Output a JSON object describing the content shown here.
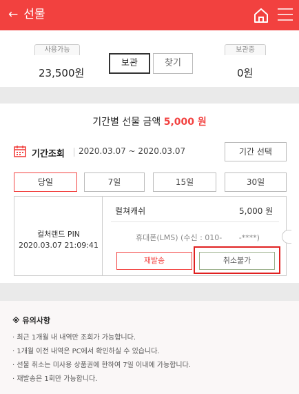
{
  "header": {
    "back_label": "선물",
    "colors": {
      "brand": "#f2413f"
    }
  },
  "storage": {
    "available_label": "사용가능",
    "available_amount": "23,500원",
    "stored_label": "보관중",
    "stored_amount": "0원",
    "store_button": "보관",
    "find_button": "찾기"
  },
  "summary": {
    "title_prefix": "기간별 선물 금액",
    "title_amount": "5,000 원"
  },
  "period": {
    "label": "기간조회",
    "range": "2020.03.07 ~ 2020.03.07",
    "select_button": "기간 선택",
    "tabs": [
      "당일",
      "7일",
      "15일",
      "30일"
    ],
    "active_tab": "당일"
  },
  "item": {
    "name": "컬처랜드 PIN",
    "datetime": "2020.03.07 21:09:41",
    "product": "컬쳐캐쉬",
    "price": "5,000  원",
    "recipient": "휴대폰(LMS) (수신 : 010-       -****)",
    "resend_button": "재발송",
    "cancel_button": "취소불가"
  },
  "notes": {
    "title": "※ 유의사항",
    "items": [
      "· 최근 1개월 내 내역만 조회가 가능합니다.",
      "· 1개월 이전 내역은 PC에서 확인하실 수 있습니다.",
      "· 선물 취소는 미사용 상품권에 한하여 7일 이내에 가능합니다.",
      "· 재발송은 1회만 가능합니다."
    ]
  }
}
